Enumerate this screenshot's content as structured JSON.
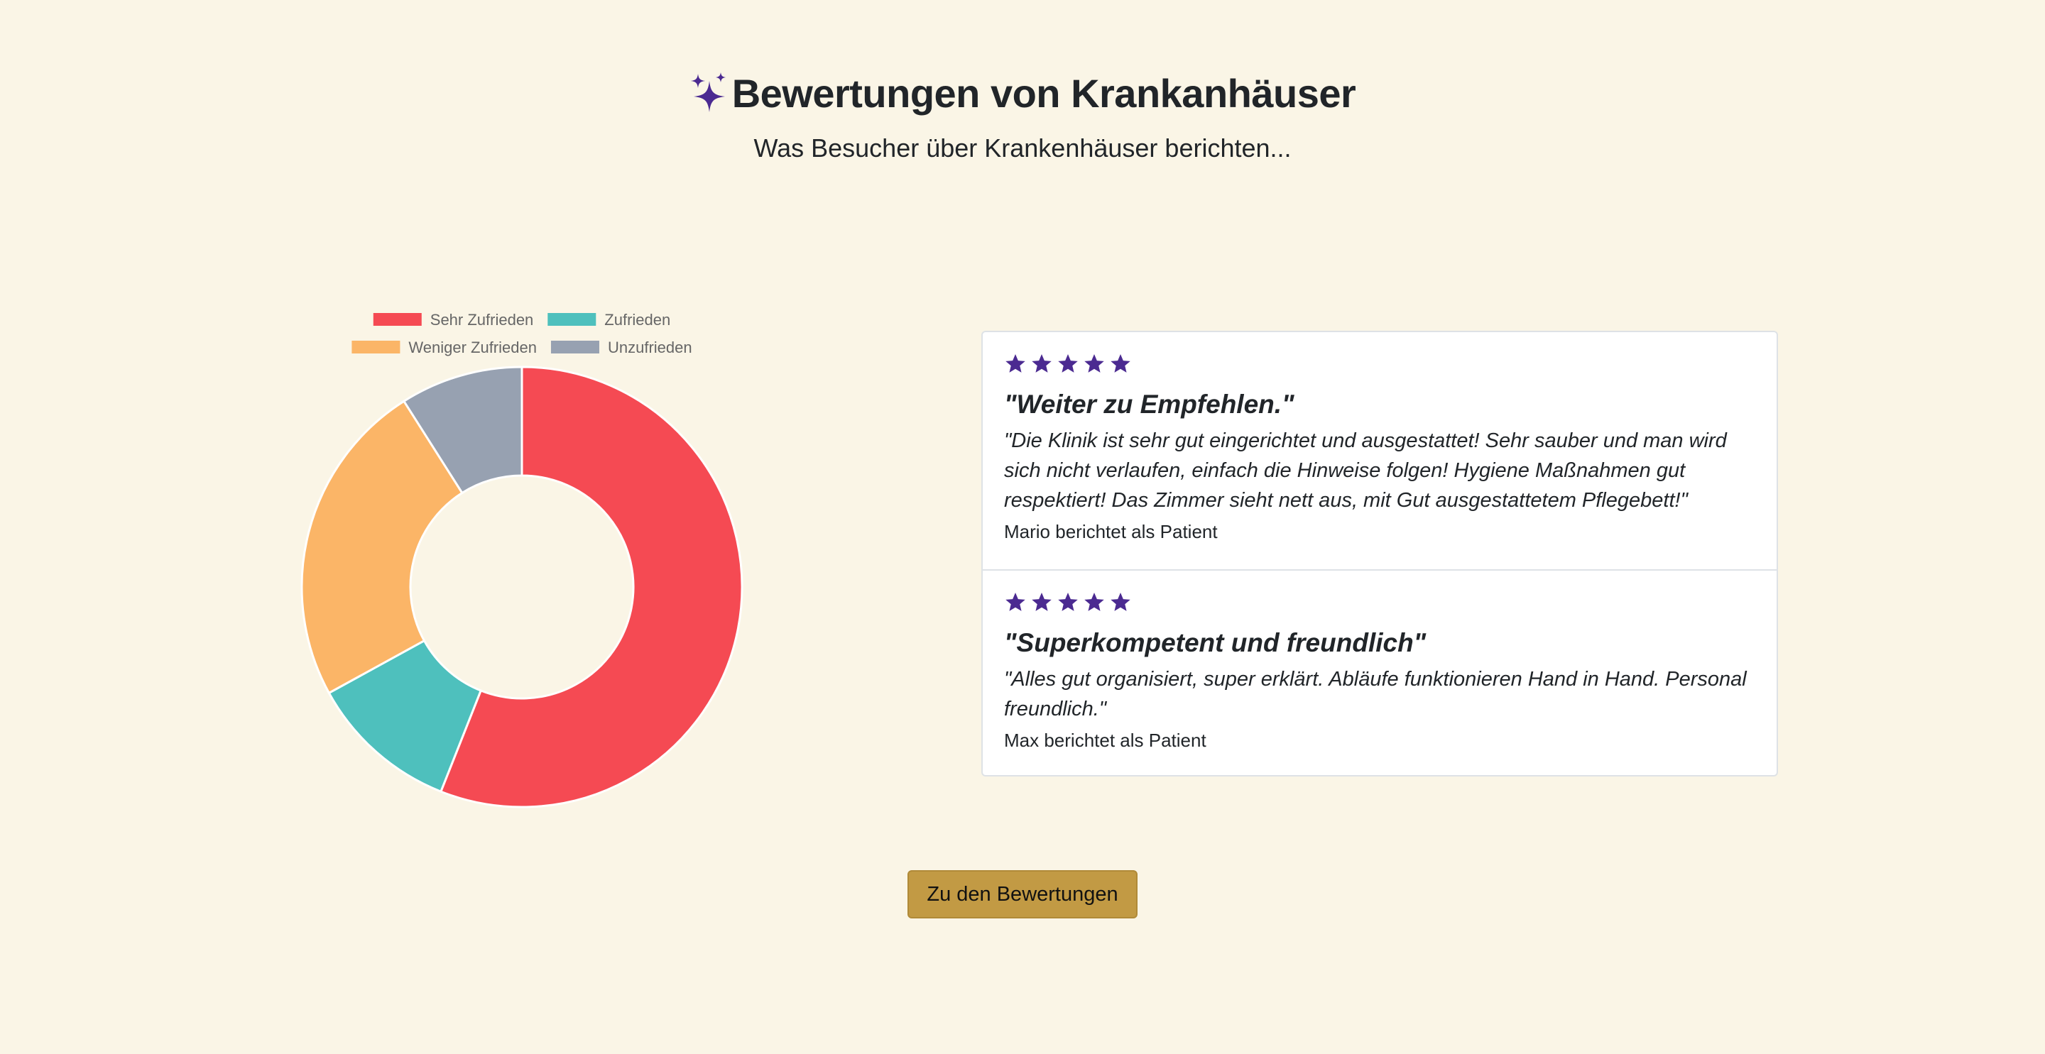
{
  "header": {
    "title": "Bewertungen von Krankanhäuser",
    "subtitle": "Was Besucher über Krankenhäuser berichten...",
    "icon": "sparkles-icon"
  },
  "colors": {
    "background": "#faf5e6",
    "accent_purple": "#4b2a91",
    "button": "#c29a44"
  },
  "chart_data": {
    "type": "doughnut",
    "categories": [
      "Sehr Zufrieden",
      "Zufrieden",
      "Weniger Zufrieden",
      "Unzufrieden"
    ],
    "values": [
      56,
      11,
      24,
      9
    ],
    "colors": [
      "#f54a53",
      "#4ec0bd",
      "#fbb567",
      "#97a1b1"
    ],
    "legend_position": "top"
  },
  "reviews": [
    {
      "stars": 5,
      "title": "\"Weiter zu Empfehlen.\"",
      "body": "\"Die Klinik ist sehr gut eingerichtet und ausgestattet! Sehr sauber und man wird sich nicht verlaufen, einfach die Hinweise folgen! Hygiene Maßnahmen gut respektiert! Das Zimmer sieht nett aus, mit Gut ausgestattetem Pflegebett!\"",
      "author": "Mario berichtet als Patient"
    },
    {
      "stars": 5,
      "title": "\"Superkompetent und freundlich\"",
      "body": "\"Alles gut organisiert, super erklärt. Abläufe funktionieren Hand in Hand. Personal freundlich.\"",
      "author": "Max berichtet als Patient"
    }
  ],
  "cta": {
    "label": "Zu den Bewertungen"
  }
}
